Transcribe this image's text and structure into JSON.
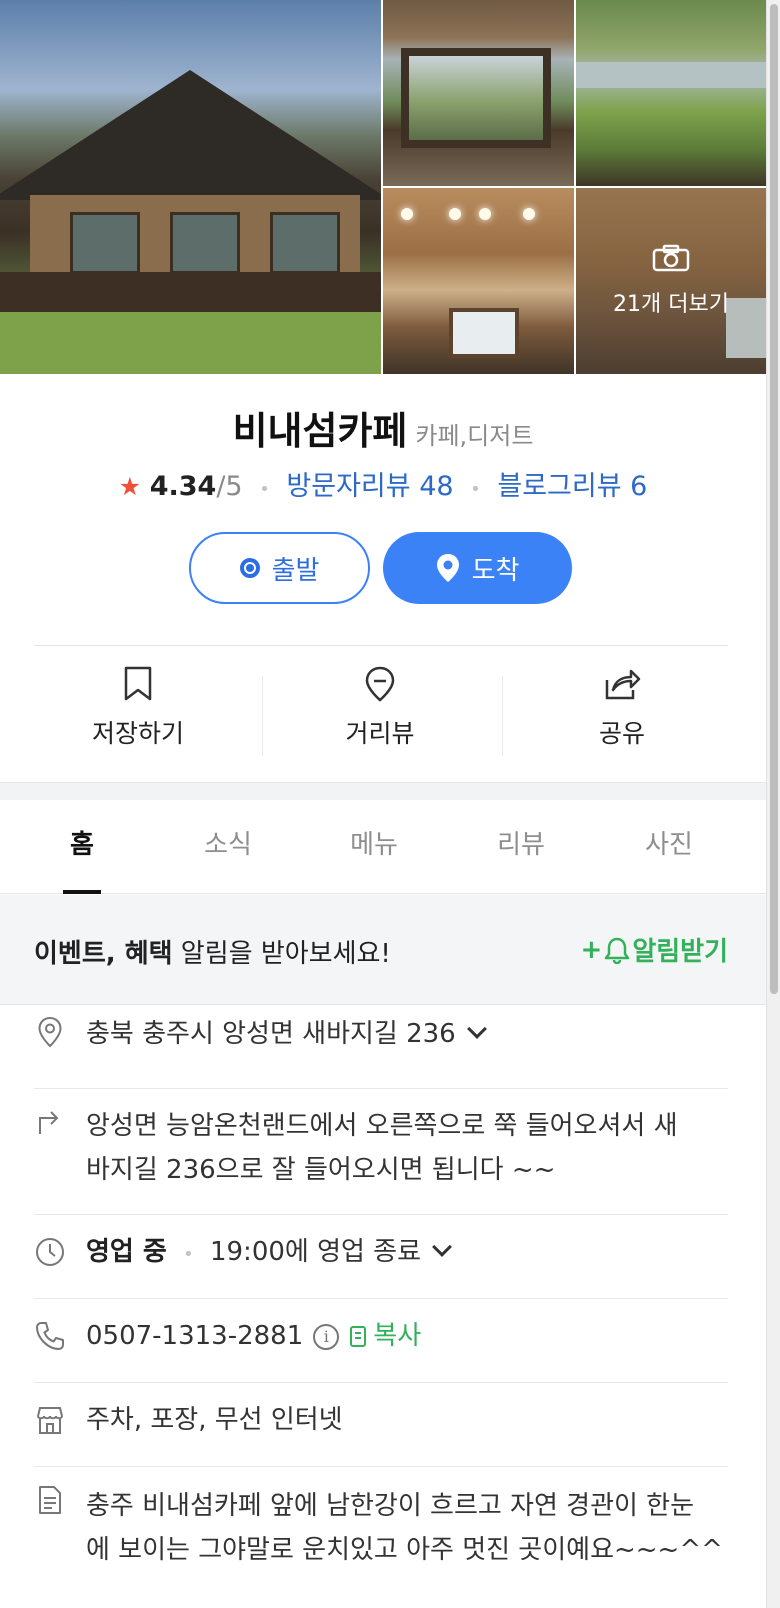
{
  "place": {
    "name": "비내섬카페",
    "category": "카페,디저트",
    "rating": "4.34",
    "rating_max": "/5",
    "visitor_review_label": "방문자리뷰 48",
    "blog_review_label": "블로그리뷰 6"
  },
  "gallery": {
    "more_label": "21개 더보기",
    "photo_count": 5
  },
  "route": {
    "depart_label": "출발",
    "arrive_label": "도착"
  },
  "actions": {
    "save_label": "저장하기",
    "streetview_label": "거리뷰",
    "share_label": "공유"
  },
  "tabs": [
    {
      "label": "홈",
      "active": true
    },
    {
      "label": "소식",
      "active": false
    },
    {
      "label": "메뉴",
      "active": false
    },
    {
      "label": "리뷰",
      "active": false
    },
    {
      "label": "사진",
      "active": false
    }
  ],
  "alarm": {
    "bold_text": "이벤트, 혜택",
    "text": " 알림을 받아보세요!",
    "button_label": "+알림받기"
  },
  "info": {
    "address": "충북 충주시 앙성면 새바지길 236",
    "directions_line1": "앙성면 능암온천랜드에서 오른쪽으로 쭉 들어오셔서 새",
    "directions_line2": "바지길 236으로 잘 들어오시면 됩니다 ~~",
    "open_status": "영업 중",
    "hours": "19:00에 영업 종료",
    "phone": "0507-1313-2881",
    "copy_label": "복사",
    "amenities": "주차, 포장, 무선 인터넷",
    "description_line1": "충주 비내섬카페 앞에 남한강이 흐르고 자연 경관이 한눈",
    "description_line2": "에 보이는 그야말로 운치있고 아주 멋진 곳이예요~~~^^"
  },
  "colors": {
    "accent_blue": "#3b82f6",
    "link_blue": "#2d69c7",
    "star_red": "#f04f3a",
    "green": "#33b15a"
  },
  "icons": [
    "star-icon",
    "camera-icon",
    "pin-icon",
    "bookmark-icon",
    "streetview-icon",
    "share-icon",
    "bell-icon",
    "location-icon",
    "directions-icon",
    "clock-icon",
    "phone-icon",
    "info-icon",
    "copy-icon",
    "store-icon",
    "document-icon",
    "chevron-down-icon"
  ]
}
